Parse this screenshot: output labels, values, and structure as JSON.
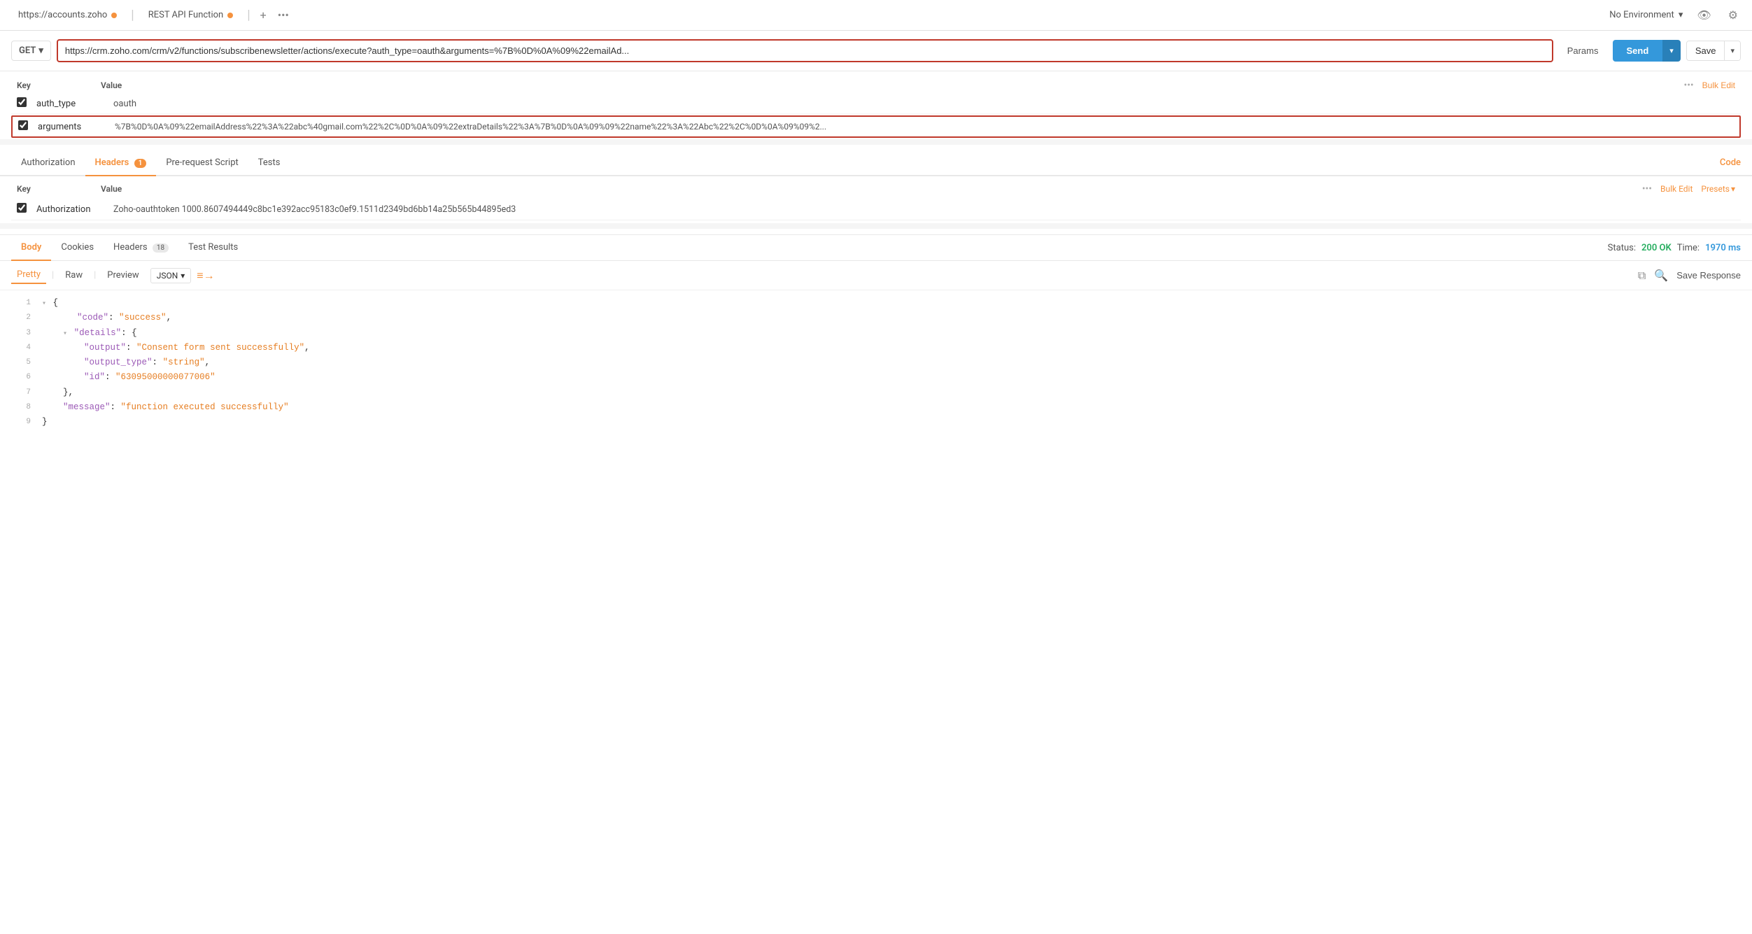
{
  "topbar": {
    "tab1_url": "https://accounts.zoho",
    "tab1_dot": "orange",
    "tab2_label": "REST API Function",
    "tab2_dot": "orange",
    "add_icon": "+",
    "more_icon": "•••",
    "env_label": "No Environment",
    "chevron_down": "▾",
    "eye_icon": "👁",
    "gear_icon": "⚙"
  },
  "request": {
    "method": "GET",
    "url": "https://crm.zoho.com/crm/v2/functions/subscribenewsletter/actions/execute?auth_type=oauth&arguments=%7B%0D%0A%09%22emailAd...",
    "params_label": "Params",
    "send_label": "Send",
    "save_label": "Save"
  },
  "query_params": {
    "col_key": "Key",
    "col_value": "Value",
    "bulk_edit_label": "Bulk Edit",
    "rows": [
      {
        "checked": true,
        "key": "auth_type",
        "value": "oauth",
        "highlighted": false
      },
      {
        "checked": true,
        "key": "arguments",
        "value": "%7B%0D%0A%09%22emailAddress%22%3A%22abc%40gmail.com%22%2C%0D%0A%09%22extraDetails%22%3A%7B%0D%0A%09%09%22name%22%3A%22Abc%22%2C%0D%0A%09%09%2...",
        "highlighted": true
      }
    ]
  },
  "request_tabs": {
    "tabs": [
      {
        "label": "Authorization",
        "active": false,
        "badge": null
      },
      {
        "label": "Headers",
        "active": true,
        "badge": "1"
      },
      {
        "label": "Pre-request Script",
        "active": false,
        "badge": null
      },
      {
        "label": "Tests",
        "active": false,
        "badge": null
      }
    ],
    "code_label": "Code"
  },
  "headers": {
    "col_key": "Key",
    "col_value": "Value",
    "bulk_edit_label": "Bulk Edit",
    "presets_label": "Presets",
    "rows": [
      {
        "checked": true,
        "key": "Authorization",
        "value": "Zoho-oauthtoken 1000.8607494449c8bc1e392acc95183c0ef9.1511d2349bd6bb14a25b565b44895ed3"
      }
    ]
  },
  "response_tabs": {
    "tabs": [
      {
        "label": "Body",
        "active": true,
        "badge": null
      },
      {
        "label": "Cookies",
        "active": false,
        "badge": null
      },
      {
        "label": "Headers",
        "active": false,
        "badge": "18"
      },
      {
        "label": "Test Results",
        "active": false,
        "badge": null
      }
    ],
    "status_label": "Status:",
    "status_value": "200 OK",
    "time_label": "Time:",
    "time_value": "1970 ms"
  },
  "response_body": {
    "tabs": [
      {
        "label": "Pretty",
        "active": true
      },
      {
        "label": "Raw",
        "active": false
      },
      {
        "label": "Preview",
        "active": false
      }
    ],
    "format_label": "JSON",
    "wrap_icon": "≡→",
    "save_response_label": "Save Response"
  },
  "json_lines": [
    {
      "num": 1,
      "content": "{",
      "collapse": true,
      "indent": 0
    },
    {
      "num": 2,
      "content": "\"code\": \"success\",",
      "key": "code",
      "value": "success",
      "indent": 1
    },
    {
      "num": 3,
      "content": "\"details\": {",
      "key": "details",
      "indent": 1,
      "collapse": true
    },
    {
      "num": 4,
      "content": "\"output\": \"Consent form sent successfully\",",
      "key": "output",
      "value": "Consent form sent successfully",
      "indent": 2
    },
    {
      "num": 5,
      "content": "\"output_type\": \"string\",",
      "key": "output_type",
      "value": "string",
      "indent": 2
    },
    {
      "num": 6,
      "content": "\"id\": \"63095000000077006\"",
      "key": "id",
      "value": "63095000000077006",
      "indent": 2
    },
    {
      "num": 7,
      "content": "},",
      "indent": 1
    },
    {
      "num": 8,
      "content": "\"message\": \"function executed successfully\"",
      "key": "message",
      "value": "function executed successfully",
      "indent": 1
    },
    {
      "num": 9,
      "content": "}",
      "indent": 0
    }
  ]
}
